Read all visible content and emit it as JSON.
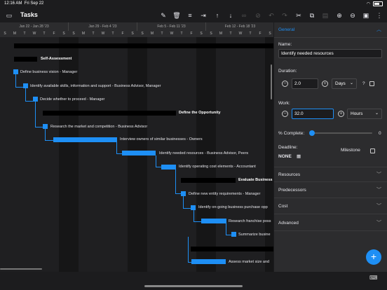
{
  "status_bar": {
    "time": "12:16 AM",
    "date": "Fri Sep 22",
    "wifi_icon": "wifi-icon",
    "battery_icon": "battery-icon"
  },
  "toolbar": {
    "title": "Tasks",
    "sidebar_icon": "sidebar-icon",
    "buttons": [
      "pencil-icon",
      "trash-icon",
      "outdent-icon",
      "indent-icon",
      "arrow-up-icon",
      "arrow-down-icon",
      "link-icon",
      "unlink-icon",
      "undo-icon",
      "redo-icon",
      "cut-icon",
      "copy-icon",
      "paste-icon",
      "zoom-in-icon",
      "zoom-out-icon",
      "save-icon",
      "more-icon"
    ]
  },
  "timeline": {
    "weeks": [
      "Jan 22 - Jan 28 '23",
      "Jan 29 - Feb 4 '23",
      "Feb 5 - Feb 11 '23",
      "Feb 12 - Feb 18 '23"
    ],
    "days": [
      "S",
      "M",
      "T",
      "W",
      "T",
      "F",
      "S",
      "S",
      "M",
      "T",
      "W",
      "T",
      "F",
      "S",
      "S",
      "M",
      "T",
      "W",
      "T",
      "F",
      "S",
      "S",
      "M",
      "T",
      "W",
      "T",
      "F",
      "S"
    ]
  },
  "tasks": [
    {
      "label": "",
      "bar": "summary"
    },
    {
      "label": "Self-Assessment",
      "bar": "summary",
      "bold": true
    },
    {
      "label": "Define business vision - Manager",
      "bar": "task"
    },
    {
      "label": "Identify available skills, information and support - Business Advisor, Manager",
      "bar": "task"
    },
    {
      "label": "Decide whether to proceed - Manager",
      "bar": "task"
    },
    {
      "label": "Define the Opportunity",
      "bar": "summary",
      "bold": true
    },
    {
      "label": "Research the market and competition - Business Advisor",
      "bar": "task"
    },
    {
      "label": "Interview owners of similar businesses - Owners",
      "bar": "task"
    },
    {
      "label": "Identify needed resources - Business Advisor, Peers",
      "bar": "task"
    },
    {
      "label": "Identify operating cost elements - Accountant",
      "bar": "task"
    },
    {
      "label": "Evaluate Business",
      "bar": "summary",
      "bold": true
    },
    {
      "label": "Define new entity requirements - Manager",
      "bar": "task"
    },
    {
      "label": "Identify on-going business purchase opp",
      "bar": "task"
    },
    {
      "label": "Research franchise poss",
      "bar": "task"
    },
    {
      "label": "Summarize busine",
      "bar": "task"
    },
    {
      "label": "",
      "bar": "summary"
    },
    {
      "label": "Assess market size and",
      "bar": "task"
    }
  ],
  "panel": {
    "general": "General",
    "name_label": "Name:",
    "name_value": "Identify needed resources",
    "duration_label": "Duration:",
    "duration_value": "2.0",
    "duration_unit": "Days",
    "estimate_mark": "?",
    "work_label": "Work:",
    "work_value": "32.0",
    "work_unit": "Hours",
    "complete_label": "% Complete:",
    "complete_value": "0",
    "deadline_label": "Deadline:",
    "deadline_value": "NONE",
    "milestone_label": "Milestone",
    "sections": [
      "Resources",
      "Predecessors",
      "Cost",
      "Advanced"
    ]
  },
  "fab": "+"
}
